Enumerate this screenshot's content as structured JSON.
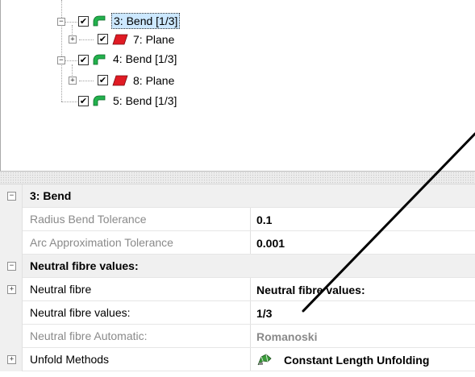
{
  "tree": {
    "nodes": [
      {
        "label": "3: Bend [1/3]",
        "icon": "bend-icon",
        "selected": true,
        "checked": true
      },
      {
        "label": "7: Plane",
        "icon": "plane-icon",
        "checked": true
      },
      {
        "label": "4: Bend [1/3]",
        "icon": "bend-icon",
        "checked": true
      },
      {
        "label": "8: Plane",
        "icon": "plane-icon",
        "checked": true
      },
      {
        "label": "5: Bend [1/3]",
        "icon": "bend-icon",
        "checked": true
      }
    ],
    "expander_collapse": "−",
    "expander_expand": "+",
    "check_mark": "✔"
  },
  "properties": {
    "category_bend": "3: Bend",
    "radius_bend_tolerance": {
      "name": "Radius Bend Tolerance",
      "value": "0.1"
    },
    "arc_approximation_tolerance": {
      "name": "Arc Approximation Tolerance",
      "value": "0.001"
    },
    "category_neutral": "Neutral fibre values:",
    "neutral_fibre": {
      "name": "Neutral fibre",
      "value": "Neutral fibre values:"
    },
    "neutral_fibre_values": {
      "name": "Neutral fibre values:",
      "value": "1/3"
    },
    "neutral_fibre_automatic": {
      "name": "Neutral fibre Automatic:",
      "value": "Romanoski"
    },
    "unfold_methods": {
      "name": "Unfold Methods",
      "value": "Constant Length Unfolding",
      "icon": "unfold-method-icon"
    }
  },
  "colors": {
    "bend_green": "#22b14c",
    "plane_red": "#e01b24",
    "selection": "#cce8ff",
    "disabled_text": "#8a8a8a",
    "gutter": "#f0f0f0"
  }
}
